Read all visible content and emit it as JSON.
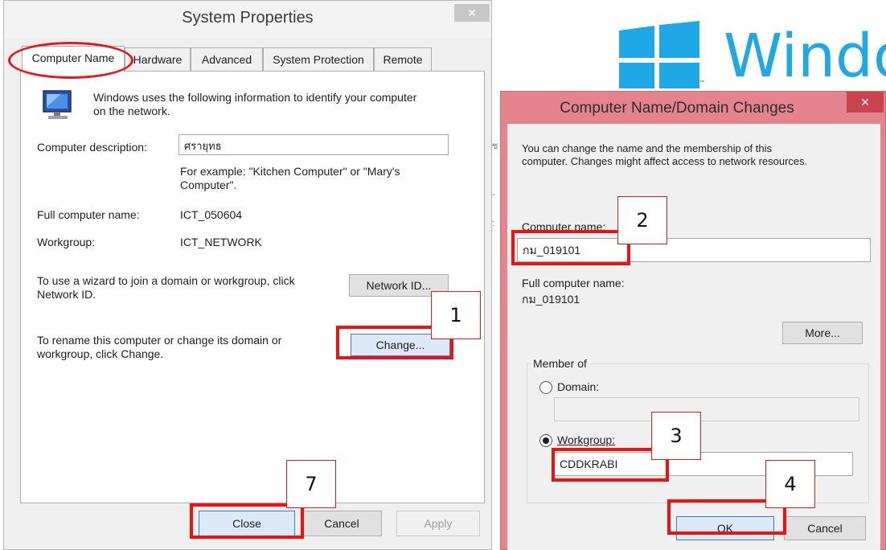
{
  "system_properties": {
    "title": "System Properties",
    "close_glyph": "✕",
    "tabs": [
      "Computer Name",
      "Hardware",
      "Advanced",
      "System Protection",
      "Remote"
    ],
    "intro_line1": "Windows uses the following information to identify your computer",
    "intro_line2": "on the network.",
    "description_label": "Computer description:",
    "description_value": "ศรายุทธ",
    "example_line1": "For example: \"Kitchen Computer\" or \"Mary's",
    "example_line2": "Computer\".",
    "full_name_label": "Full computer name:",
    "full_name_value": "ICT_050604",
    "workgroup_label": "Workgroup:",
    "workgroup_value": "ICT_NETWORK",
    "wizard_line1": "To use a wizard to join a domain or workgroup, click",
    "wizard_line2": "Network ID.",
    "network_id_button": "Network ID...",
    "rename_line1": "To rename this computer or change its domain or",
    "rename_line2": "workgroup, click Change.",
    "change_button": "Change...",
    "close_button": "Close",
    "cancel_button": "Cancel",
    "apply_button": "Apply"
  },
  "background": {
    "logo_text": "Windows",
    "tm": "™"
  },
  "name_dialog": {
    "title": "Computer Name/Domain Changes",
    "close_glyph": "✕",
    "intro_line1": "You can change the name and the membership of this",
    "intro_line2": "computer. Changes might affect access to network resources.",
    "computer_name_label": "Computer name:",
    "computer_name_value": "กม_019101",
    "full_name_label": "Full computer name:",
    "full_name_value": "กม_019101",
    "more_button": "More...",
    "member_of_legend": "Member of",
    "domain_label": "Domain:",
    "domain_value": "",
    "workgroup_label": "Workgroup:",
    "workgroup_value": "CDDKRABI",
    "ok_button": "OK",
    "cancel_button": "Cancel"
  },
  "annotations": [
    "1",
    "2",
    "3",
    "4",
    "7"
  ],
  "colors": {
    "highlight_red": "#ee1111",
    "dialog_frame": "#e5848c",
    "windows_blue": "#1ea9e6"
  },
  "icons": {
    "window_close": "close-icon",
    "computer": "computer-monitor-icon",
    "logo": "windows-logo-icon"
  }
}
